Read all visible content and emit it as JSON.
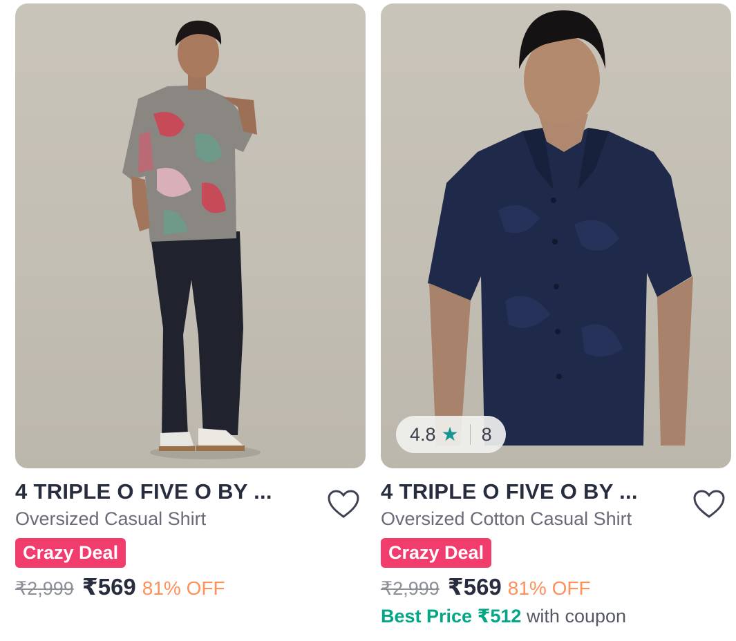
{
  "products": [
    {
      "brand": "4 TRIPLE O FIVE O BY ...",
      "subtitle": "Oversized Casual Shirt",
      "badge": "Crazy Deal",
      "mrp": "₹2,999",
      "price": "₹569",
      "discount": "81% OFF"
    },
    {
      "brand": "4 TRIPLE O FIVE O BY ...",
      "subtitle": "Oversized Cotton Casual Shirt",
      "badge": "Crazy Deal",
      "mrp": "₹2,999",
      "price": "₹569",
      "discount": "81% OFF",
      "rating": "4.8",
      "rating_count": "8",
      "best_price_label": "Best Price ₹512",
      "best_price_suffix": "with coupon"
    }
  ],
  "colors": {
    "badge": "#f13c6e",
    "discount": "#ff905a",
    "best_price": "#03a685",
    "star": "#14958f"
  }
}
